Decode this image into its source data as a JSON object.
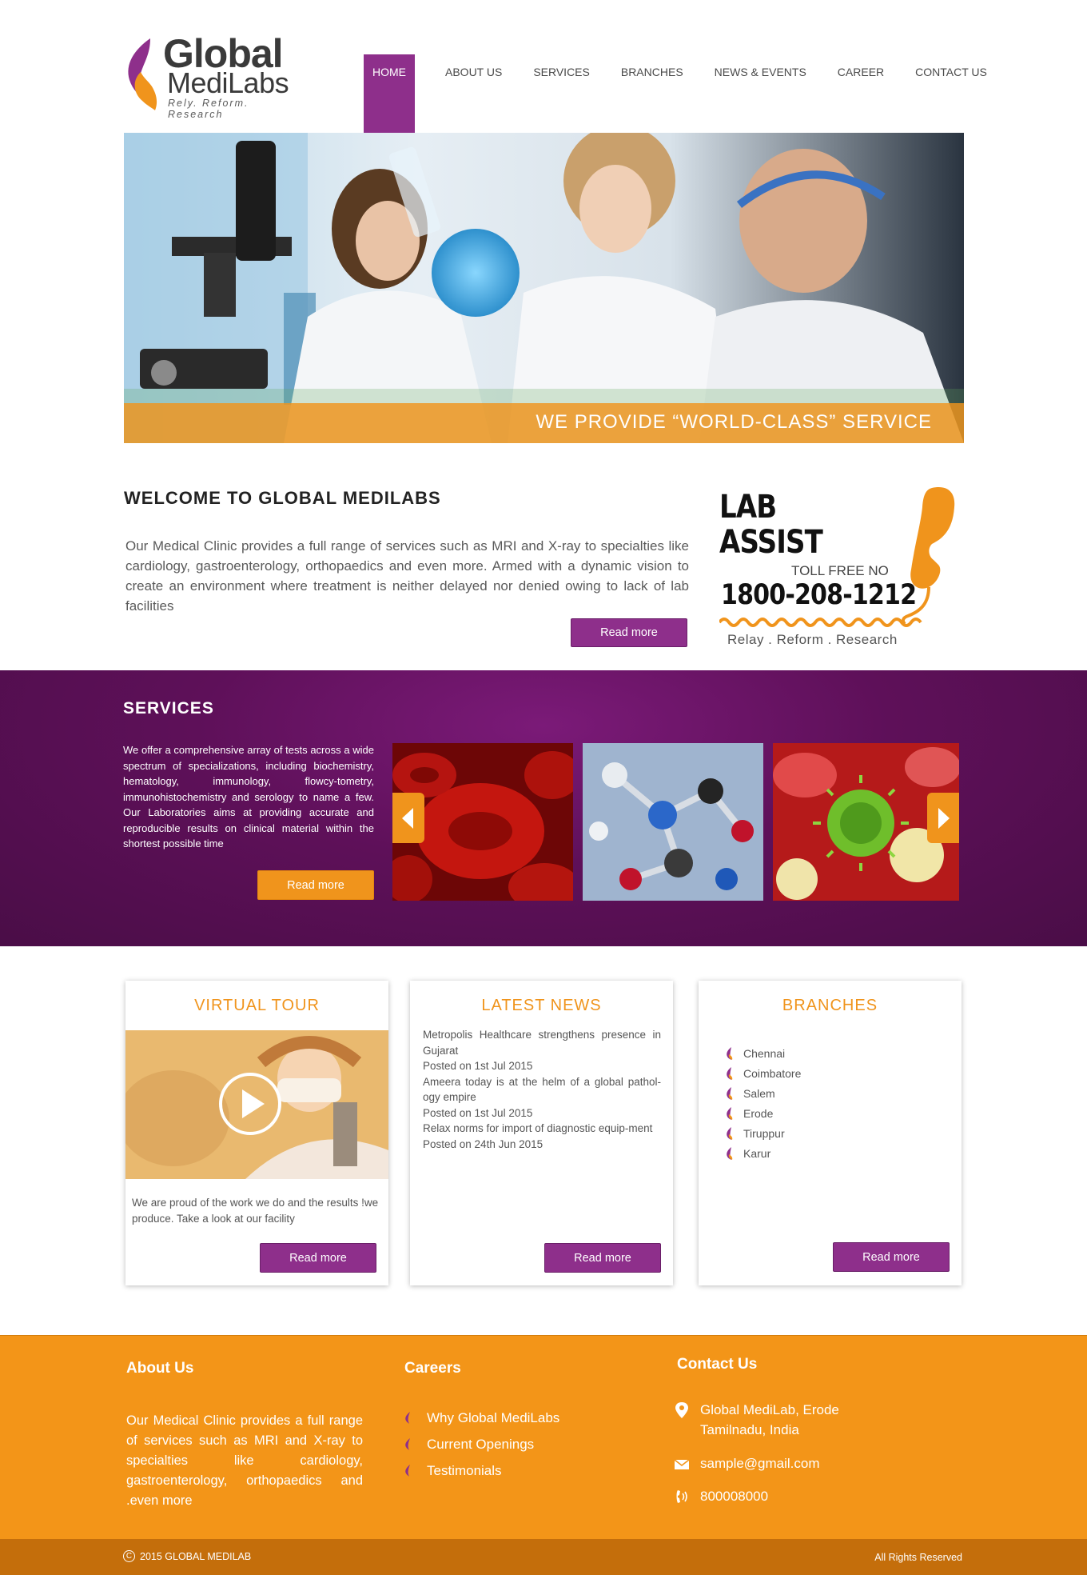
{
  "logo": {
    "line1": "Global",
    "line2": "MediLabs",
    "tagline": "Rely. Reform. Research"
  },
  "nav": {
    "items": [
      {
        "label": "HOME",
        "active": true
      },
      {
        "label": "ABOUT US"
      },
      {
        "label": "SERVICES"
      },
      {
        "label": "BRANCHES"
      },
      {
        "label": "NEWS & EVENTS"
      },
      {
        "label": "CAREER"
      },
      {
        "label": "CONTACT US"
      }
    ]
  },
  "hero": {
    "caption": "WE PROVIDE “WORLD-CLASS” SERVICE"
  },
  "welcome": {
    "title": "WELCOME TO GLOBAL MEDILABS",
    "text": "Our Medical Clinic provides a full range of services such as MRI and X-ray to specialties like cardiology, gastroenterology, orthopaedics and even more. Armed with a dynamic vision to create an environment where treatment is neither delayed nor denied owing to lack of lab facilities",
    "read_more": "Read more"
  },
  "lab_assist": {
    "line1": "LAB",
    "line2": "ASSIST",
    "toll_free": "TOLL FREE NO",
    "number": "1800-208-1212",
    "tagline": "Relay . Reform . Research"
  },
  "services": {
    "title": "SERVICES",
    "text": "We offer a comprehensive array of tests across a wide spectrum of specializations, including biochemistry, hematology, immunology, flowcy-tometry, immunohistochemistry and serology to name a few. Our Laboratories aims at providing accurate and reproducible results on clinical material within the shortest possible time",
    "read_more": "Read more"
  },
  "cards": {
    "tour": {
      "title": "VIRTUAL TOUR",
      "text": "We are proud of the work we do and the results !we produce. Take a look at our facility",
      "read_more": "Read more"
    },
    "news": {
      "title": "LATEST NEWS",
      "items": [
        "Metropolis Healthcare strengthens presence in Gujarat",
        "Posted on 1st Jul 2015",
        "Ameera today is at the helm of a global pathol-ogy empire",
        "Posted on 1st Jul 2015",
        "Relax norms for import of diagnostic equip-ment",
        "Posted on 24th Jun 2015"
      ],
      "read_more": "Read more"
    },
    "branches": {
      "title": "BRANCHES",
      "items": [
        "Chennai",
        "Coimbatore",
        "Salem",
        "Erode",
        "Tiruppur",
        "Karur"
      ],
      "read_more": "Read more"
    }
  },
  "footer": {
    "about_title": "About Us",
    "about_text": "Our Medical Clinic provides a full range of services such as MRI and X-ray to specialties like cardiology, gastroenterology, orthopaedics and .even more",
    "careers_title": "Careers",
    "careers": [
      "Why Global MediLabs",
      "Current Openings",
      "Testimonials"
    ],
    "contact_title": "Contact Us",
    "address_line1": "Global MediLab, Erode",
    "address_line2": "Tamilnadu, India",
    "email": "sample@gmail.com",
    "phone": "800008000"
  },
  "bottom": {
    "copyright_symbol": "C",
    "copyright": "2015  GLOBAL MEDILAB",
    "rights": "All Rights Reserved"
  },
  "colors": {
    "brand_purple": "#8e2f8b",
    "brand_orange": "#f0941c",
    "footer_orange": "#f39518",
    "bottom_bar": "#c46e0b"
  }
}
